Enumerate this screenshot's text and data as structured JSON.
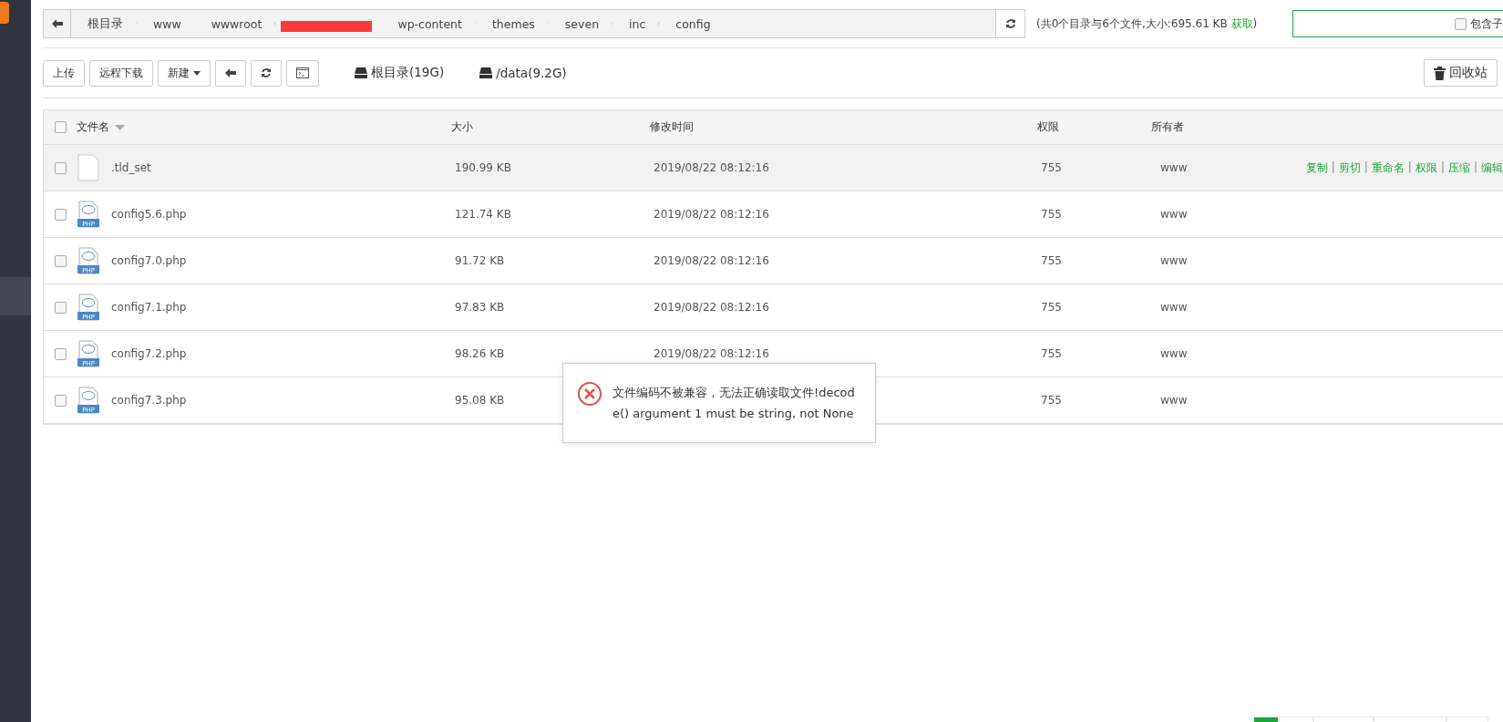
{
  "breadcrumb": [
    {
      "kind": "text",
      "label": "根目录"
    },
    {
      "kind": "text",
      "label": "www"
    },
    {
      "kind": "text",
      "label": "wwwroot"
    },
    {
      "kind": "redacted"
    },
    {
      "kind": "text",
      "label": "wp-content"
    },
    {
      "kind": "text",
      "label": "themes"
    },
    {
      "kind": "text",
      "label": "seven"
    },
    {
      "kind": "text",
      "label": "inc"
    },
    {
      "kind": "text",
      "label": "config"
    }
  ],
  "summary": {
    "text": "(共0个目录与6个文件,大小:695.61 KB",
    "link": "获取",
    "close": ")"
  },
  "search": {
    "checkbox_label": "包含子",
    "checked": false
  },
  "toolbar": [
    {
      "kind": "text",
      "label": "上传"
    },
    {
      "kind": "text",
      "label": "远程下载"
    },
    {
      "kind": "dropdown",
      "label": "新建"
    },
    {
      "kind": "back"
    },
    {
      "kind": "refresh"
    },
    {
      "kind": "terminal"
    }
  ],
  "disks": [
    {
      "label": "根目录(19G)"
    },
    {
      "label": "/data(9.2G)"
    }
  ],
  "recycle": {
    "label": "回收站"
  },
  "table": {
    "header_checked": false,
    "columns": [
      "文件名",
      "大小",
      "修改时间",
      "权限",
      "所有者"
    ],
    "rows": [
      {
        "kind": "file",
        "name": ".tld_set",
        "size": "190.99 KB",
        "time": "2019/08/22 08:12:16",
        "perm": "755",
        "owner": "www",
        "checked": false,
        "hovered": true,
        "action_separator": "|",
        "actions": [
          "复制",
          "剪切",
          "重命名",
          "权限",
          "压缩",
          "编辑"
        ]
      },
      {
        "kind": "php",
        "badge": "PHP",
        "name": "config5.6.php",
        "size": "121.74 KB",
        "time": "2019/08/22 08:12:16",
        "perm": "755",
        "owner": "www",
        "checked": false,
        "hovered": false
      },
      {
        "kind": "php",
        "badge": "PHP",
        "name": "config7.0.php",
        "size": "91.72 KB",
        "time": "2019/08/22 08:12:16",
        "perm": "755",
        "owner": "www",
        "checked": false,
        "hovered": false
      },
      {
        "kind": "php",
        "badge": "PHP",
        "name": "config7.1.php",
        "size": "97.83 KB",
        "time": "2019/08/22 08:12:16",
        "perm": "755",
        "owner": "www",
        "checked": false,
        "hovered": false
      },
      {
        "kind": "php",
        "badge": "PHP",
        "name": "config7.2.php",
        "size": "98.26 KB",
        "time": "2019/08/22 08:12:16",
        "perm": "755",
        "owner": "www",
        "checked": false,
        "hovered": false
      },
      {
        "kind": "php",
        "badge": "PHP",
        "name": "config7.3.php",
        "size": "95.08 KB",
        "perm": "755",
        "owner": "www",
        "checked": false,
        "hovered": false
      }
    ]
  },
  "error": {
    "message": "文件编码不被兼容，无法正确读取文件!decode() argument 1 must be string, not None"
  },
  "pager": [
    {
      "selected": true
    },
    {
      "selected": false
    },
    {
      "selected": false
    },
    {
      "selected": false
    },
    {
      "selected": false
    }
  ]
}
